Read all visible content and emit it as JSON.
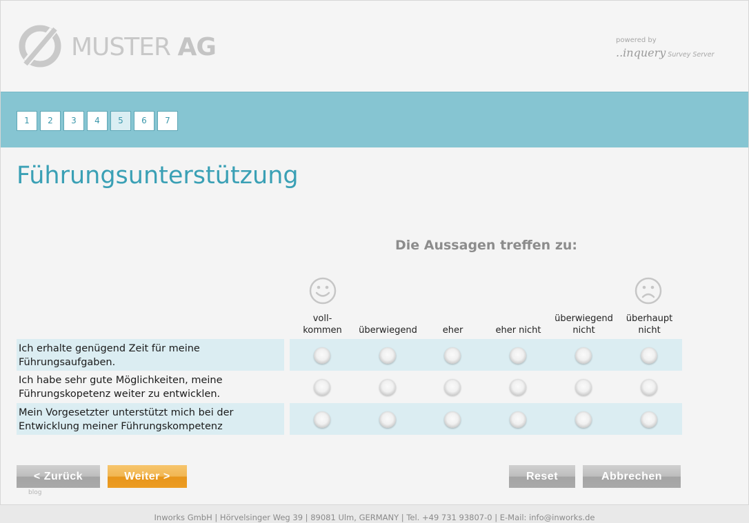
{
  "brand": {
    "logo_text_light": "MUSTER",
    "logo_text_bold": "AG",
    "powered_by": "powered by",
    "powered_brand": "..inquery",
    "powered_brand_suffix": "Survey Server"
  },
  "pagination": {
    "pages": [
      "1",
      "2",
      "3",
      "4",
      "5",
      "6",
      "7"
    ],
    "current": "5"
  },
  "page": {
    "title": "Führungsunterstützung"
  },
  "survey": {
    "scale_header": "Die Aussagen treffen zu:",
    "columns": [
      {
        "line1": "voll-",
        "line2": "kommen"
      },
      {
        "line1": "",
        "line2": "überwiegend"
      },
      {
        "line1": "",
        "line2": "eher"
      },
      {
        "line1": "",
        "line2": "eher nicht"
      },
      {
        "line1": "überwiegend",
        "line2": "nicht"
      },
      {
        "line1": "überhaupt",
        "line2": "nicht"
      }
    ],
    "rows": [
      {
        "line1": "Ich erhalte genügend Zeit für meine",
        "line2": "Führungsaufgaben."
      },
      {
        "line1": "Ich habe sehr gute Möglichkeiten, meine",
        "line2": "Führungskopetenz weiter zu entwicklen."
      },
      {
        "line1": "Mein Vorgesetzter unterstützt mich bei der",
        "line2": "Entwicklung meiner Führungskompetenz"
      }
    ]
  },
  "buttons": {
    "back": "< Zurück",
    "next": "Weiter >",
    "reset": "Reset",
    "cancel": "Abbrechen"
  },
  "blog_label": "blog",
  "footer": "Inworks GmbH | Hörvelsinger Weg 39 | 89081 Ulm, GERMANY | Tel. +49 731 93807-0 | E-Mail: info@inworks.de",
  "icons": {
    "logo": "circle-slash-logo-icon",
    "positive_end": "smiley-happy-icon",
    "negative_end": "smiley-sad-icon"
  },
  "colors": {
    "accent": "#3aa0b5",
    "nav_band": "#86c5d2",
    "row_shade": "#dbedf2",
    "primary_button": "#ec9c22",
    "secondary_button": "#a9a9a9"
  }
}
